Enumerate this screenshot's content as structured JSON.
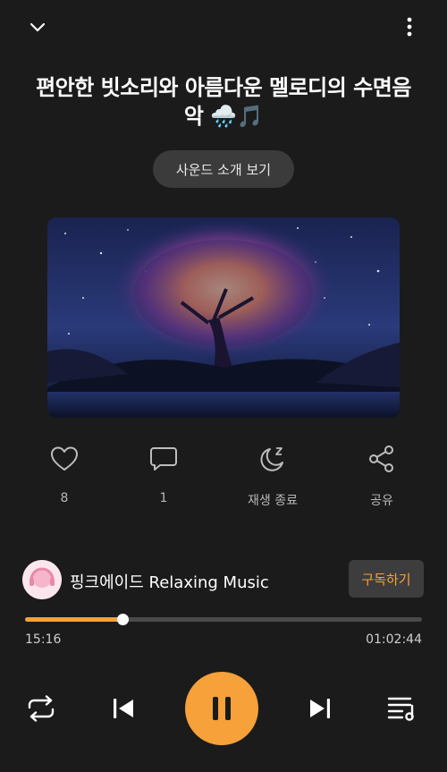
{
  "header": {
    "title": "편안한 빗소리와 아름다운 멜로디의 수면음악 🌧️🎵",
    "sound_info_label": "사운드 소개 보기"
  },
  "actions": {
    "like": {
      "icon": "heart-icon",
      "count": "8"
    },
    "comment": {
      "icon": "comment-icon",
      "count": "1"
    },
    "sleep": {
      "icon": "moon-sleep-icon",
      "label": "재생 종료"
    },
    "share": {
      "icon": "share-icon",
      "label": "공유"
    }
  },
  "channel": {
    "name": "핑크에이드 Relaxing Music",
    "subscribe_label": "구독하기"
  },
  "player": {
    "elapsed": "15:16",
    "total": "01:02:44",
    "progress_fraction": 0.245
  },
  "colors": {
    "accent": "#f6a13a",
    "background": "#1b1b1b",
    "button_bg": "#3b3b3b"
  }
}
